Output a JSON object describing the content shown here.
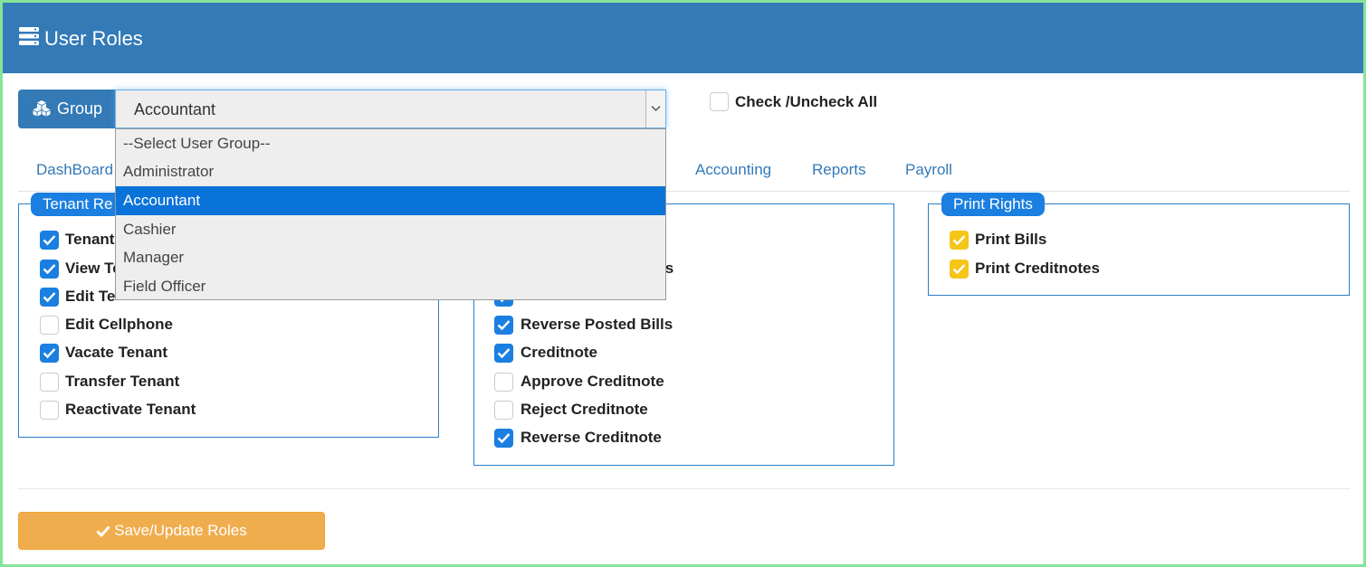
{
  "header": {
    "title": "User Roles",
    "icon": "server-stack-icon"
  },
  "group": {
    "button_label": "Group",
    "icon": "cubes-icon",
    "selected": "Accountant",
    "options": [
      "--Select User Group--",
      "Administrator",
      "Accountant",
      "Cashier",
      "Manager",
      "Field Officer"
    ]
  },
  "check_all": {
    "label": "Check /Uncheck All",
    "checked": false
  },
  "tabs": [
    {
      "label": "DashBoard"
    },
    {
      "label": "Accounting"
    },
    {
      "label": "Reports"
    },
    {
      "label": "Payroll"
    }
  ],
  "panels": {
    "tenant": {
      "legend": "Tenant Re",
      "items": [
        {
          "label": "Tenant",
          "checked": true
        },
        {
          "label": "View Te",
          "checked": true
        },
        {
          "label": "Edit Te",
          "checked": true
        },
        {
          "label": "Edit Cellphone",
          "checked": false
        },
        {
          "label": "Vacate Tenant",
          "checked": true
        },
        {
          "label": "Transfer Tenant",
          "checked": false
        },
        {
          "label": "Reactivate Tenant",
          "checked": false
        }
      ]
    },
    "bills": {
      "items": [
        {
          "label": "ls",
          "checked": null
        },
        {
          "label": "",
          "checked": true
        },
        {
          "label": "Reverse Posted Bills",
          "checked": true
        },
        {
          "label": "Creditnote",
          "checked": true
        },
        {
          "label": "Approve Creditnote",
          "checked": false
        },
        {
          "label": "Reject Creditnote",
          "checked": false
        },
        {
          "label": "Reverse Creditnote",
          "checked": true
        }
      ]
    },
    "print": {
      "legend": "Print Rights",
      "items": [
        {
          "label": "Print Bills",
          "checked": true
        },
        {
          "label": "Print Creditnotes",
          "checked": true
        }
      ]
    }
  },
  "colors": {
    "header": "#337ab7",
    "accent": "#1a7fe0",
    "print_check": "#f5c518",
    "save": "#f0ad4e"
  },
  "save_button": {
    "label": "Save/Update Roles",
    "icon": "check-icon"
  }
}
